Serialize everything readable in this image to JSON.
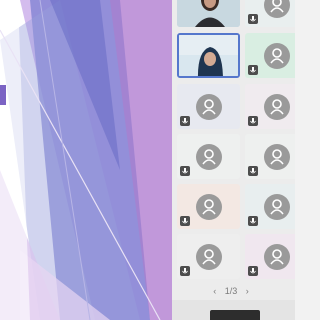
{
  "gallery": {
    "pagination": {
      "text": "1/3"
    },
    "tiles": [
      {
        "kind": "video",
        "bg": "#b9ccd6",
        "muted": false
      },
      {
        "kind": "avatar",
        "bg": "#e9efef",
        "muted": true
      },
      {
        "kind": "video",
        "bg": "#d7e6ef",
        "muted": true,
        "selected": true
      },
      {
        "kind": "avatar",
        "bg": "#d9eee2",
        "muted": true
      },
      {
        "kind": "avatar",
        "bg": "#e7e9f0",
        "muted": true
      },
      {
        "kind": "avatar",
        "bg": "#f0ebef",
        "muted": true
      },
      {
        "kind": "avatar",
        "bg": "#eef0ef",
        "muted": true
      },
      {
        "kind": "avatar",
        "bg": "#eef0ef",
        "muted": true
      },
      {
        "kind": "avatar",
        "bg": "#f3e8e3",
        "muted": true
      },
      {
        "kind": "avatar",
        "bg": "#e8eeef",
        "muted": true
      },
      {
        "kind": "avatar",
        "bg": "#eeeeee",
        "muted": true
      },
      {
        "kind": "avatar",
        "bg": "#f0e7ef",
        "muted": true
      }
    ]
  },
  "colors": {
    "slide_purple_light": "#c9a0e6",
    "slide_purple_mid": "#9b7fd4",
    "slide_blue": "#6f71c8",
    "selected_border": "#5577cc"
  }
}
